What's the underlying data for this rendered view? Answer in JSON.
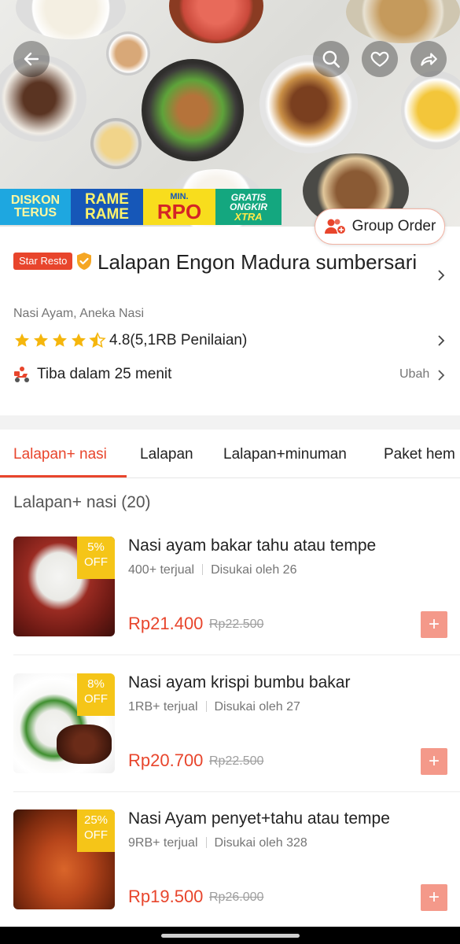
{
  "hero": {
    "icons": [
      "back-arrow-icon",
      "search-icon",
      "heart-icon",
      "share-icon"
    ],
    "promos": {
      "p1_line1": "DISKON",
      "p1_line2": "TERUS",
      "p2_line1": "RAME",
      "p2_line2": "RAME",
      "p3_small": "MIN.",
      "p3_main": "RPO",
      "p4_line1": "GRATIS",
      "p4_line2": "ONGKIR",
      "p4_line3": "XTRA"
    },
    "group_order_label": "Group Order"
  },
  "restaurant": {
    "badge": "Star Resto",
    "name": "Lalapan Engon Madura sumbersari",
    "category": "Nasi Ayam, Aneka Nasi",
    "rating_value": 4.5,
    "rating_text": "4.8(5,1RB Penilaian)",
    "delivery": "Tiba dalam 25 menit",
    "change_label": "Ubah"
  },
  "tabs": [
    "Lalapan+ nasi",
    "Lalapan",
    "Lalapan+minuman",
    "Paket hem"
  ],
  "section_title": "Lalapan+ nasi (20)",
  "items": [
    {
      "discount_pct": "5%",
      "discount_off": "OFF",
      "title": "Nasi ayam bakar tahu atau tempe",
      "sold": "400+ terjual",
      "liked": "Disukai oleh 26",
      "price": "Rp21.400",
      "old_price": "Rp22.500"
    },
    {
      "discount_pct": "8%",
      "discount_off": "OFF",
      "title": "Nasi ayam krispi bumbu bakar",
      "sold": "1RB+ terjual",
      "liked": "Disukai oleh 27",
      "price": "Rp20.700",
      "old_price": "Rp22.500"
    },
    {
      "discount_pct": "25%",
      "discount_off": "OFF",
      "title": "Nasi Ayam penyet+tahu atau tempe",
      "sold": "9RB+ terjual",
      "liked": "Disukai oleh 328",
      "price": "Rp19.500",
      "old_price": "Rp26.000"
    }
  ],
  "colors": {
    "accent": "#e8452c",
    "discount": "#f5c518",
    "add_button": "#f4998a"
  }
}
